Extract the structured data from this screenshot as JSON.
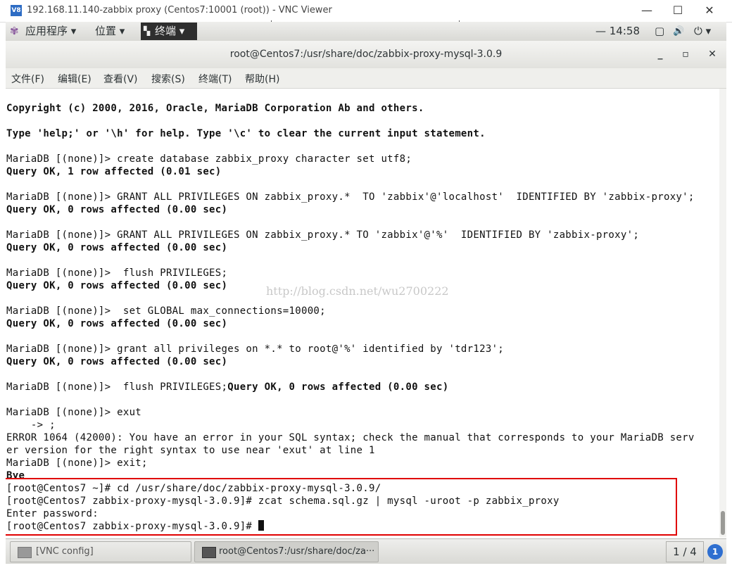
{
  "vnc": {
    "title": "192.168.11.140-zabbix proxy (Centos7:10001 (root)) - VNC Viewer",
    "logo": "V8",
    "minimize": "—",
    "maximize": "☐",
    "close": "✕"
  },
  "gnome_bar": {
    "apps_icon": "✾",
    "apps": "应用程序 ▾",
    "places": "位置 ▾",
    "terminal": "终端 ▾",
    "clock": "— 14:58",
    "tray_box": "▢",
    "volume": "🔊",
    "power": "⏻ ▾"
  },
  "terminal": {
    "title": "root@Centos7:/usr/share/doc/zabbix-proxy-mysql-3.0.9",
    "minimize": "_",
    "maximize": "▫",
    "close": "✕",
    "menu": [
      "文件(F)",
      "编辑(E)",
      "查看(V)",
      "搜索(S)",
      "终端(T)",
      "帮助(H)"
    ],
    "lines": [
      "Copyright (c) 2000, 2016, Oracle, MariaDB Corporation Ab and others.",
      "",
      "Type 'help;' or '\\h' for help. Type '\\c' to clear the current input statement.",
      "",
      "MariaDB [(none)]> create database zabbix_proxy character set utf8;",
      "Query OK, 1 row affected (0.01 sec)",
      "",
      "MariaDB [(none)]> GRANT ALL PRIVILEGES ON zabbix_proxy.*  TO 'zabbix'@'localhost'  IDENTIFIED BY 'zabbix-proxy';",
      "Query OK, 0 rows affected (0.00 sec)",
      "",
      "MariaDB [(none)]> GRANT ALL PRIVILEGES ON zabbix_proxy.* TO 'zabbix'@'%'  IDENTIFIED BY 'zabbix-proxy';",
      "Query OK, 0 rows affected (0.00 sec)",
      "",
      "MariaDB [(none)]>  flush PRIVILEGES;",
      "Query OK, 0 rows affected (0.00 sec)",
      "",
      "MariaDB [(none)]>  set GLOBAL max_connections=10000;",
      "Query OK, 0 rows affected (0.00 sec)",
      "",
      "MariaDB [(none)]> grant all privileges on *.* to root@'%' identified by 'tdr123';",
      "Query OK, 0 rows affected (0.00 sec)",
      "",
      "MariaDB [(none)]>  flush PRIVILEGES;",
      "Query OK, 0 rows affected (0.00 sec)",
      "",
      "MariaDB [(none)]> exut",
      "    -> ;",
      "ERROR 1064 (42000): You have an error in your SQL syntax; check the manual that corresponds to your MariaDB serv",
      "er version for the right syntax to use near 'exut' at line 1",
      "MariaDB [(none)]> exit;",
      "Bye",
      "[root@Centos7 ~]# cd /usr/share/doc/zabbix-proxy-mysql-3.0.9/",
      "[root@Centos7 zabbix-proxy-mysql-3.0.9]# zcat schema.sql.gz | mysql -uroot -p zabbix_proxy",
      "Enter password:",
      "[root@Centos7 zabbix-proxy-mysql-3.0.9]# "
    ],
    "watermark": "http://blog.csdn.net/wu2700222"
  },
  "taskbar": {
    "vnc_config": "[VNC config]",
    "terminal_task": "root@Centos7:/usr/share/doc/za···",
    "pager": "1 / 4",
    "notify_count": "1"
  }
}
